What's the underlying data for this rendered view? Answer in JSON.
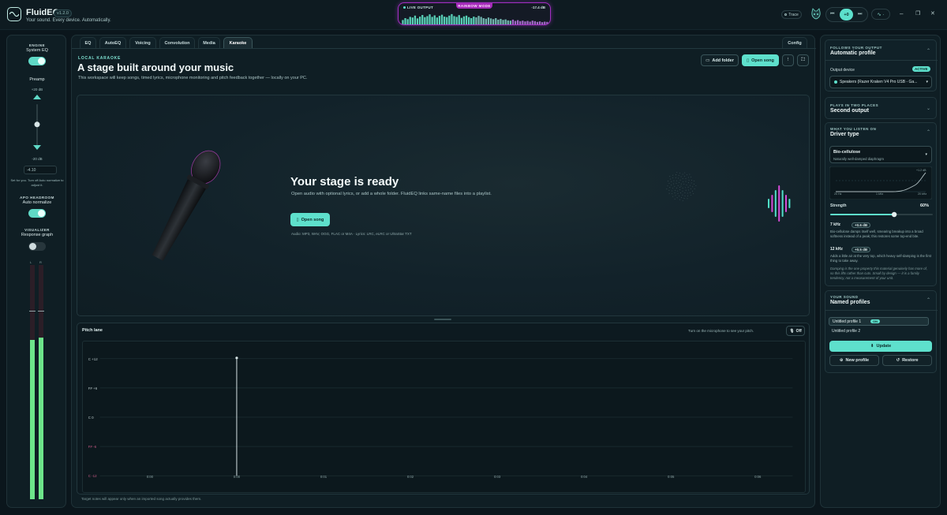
{
  "app": {
    "title": "FluidEQ",
    "version": "v1.2.0",
    "tagline": "Your sound. Every device. Automatically."
  },
  "live_output": {
    "label": "LIVE OUTPUT",
    "mode": "RAINBOW MODE",
    "db": "-17.4 dB",
    "levels": [
      0.35,
      0.5,
      0.42,
      0.6,
      0.55,
      0.7,
      0.48,
      0.62,
      0.75,
      0.58,
      0.66,
      0.8,
      0.6,
      0.72,
      0.55,
      0.68,
      0.77,
      0.62,
      0.58,
      0.7,
      0.82,
      0.66,
      0.6,
      0.74,
      0.52,
      0.64,
      0.7,
      0.58,
      0.5,
      0.62,
      0.56,
      0.68,
      0.6,
      0.5,
      0.45,
      0.55,
      0.48,
      0.42,
      0.5,
      0.38,
      0.44,
      0.36,
      0.4,
      0.32,
      0.3,
      0.38,
      0.28,
      0.34,
      0.26,
      0.3,
      0.24,
      0.28,
      0.22,
      0.3,
      0.26,
      0.2,
      0.24,
      0.18,
      0.22,
      0.2
    ]
  },
  "topbar": {
    "trace_label": "Trace",
    "play_label": "+0",
    "prev_icon": "skip-back-icon",
    "next_icon": "skip-forward-icon",
    "wave_label": "∿ ·",
    "minimize_glyph": "–",
    "restore_glyph": "❐",
    "close_glyph": "✕"
  },
  "left": {
    "engine_caption": "ENGINE",
    "engine_label": "System EQ",
    "engine_on": true,
    "preamp_label": "Preamp",
    "preamp_max": "+20 dB",
    "preamp_min": "-20 dB",
    "preamp_value": "-4.10",
    "preamp_level": 0.4,
    "preamp_hint": "Set for you. Turn off Auto normalize to adjust it.",
    "apo_caption": "APO HEADROOM",
    "apo_label": "Auto normalize",
    "apo_on": true,
    "vis_caption": "VISUALIZER",
    "vis_label": "Response graph",
    "vis_on": false,
    "meter_left_label": "L",
    "meter_right_label": "R",
    "meter_left_level": 0.68,
    "meter_right_level": 0.69
  },
  "tabs": [
    {
      "label": "EQ",
      "active": false
    },
    {
      "label": "AutoEQ",
      "active": false
    },
    {
      "label": "Voicing",
      "active": false
    },
    {
      "label": "Convolution",
      "active": false
    },
    {
      "label": "Media",
      "active": false
    },
    {
      "label": "Karaoke",
      "active": true
    },
    {
      "label": "Config",
      "active": false
    }
  ],
  "karaoke": {
    "caption": "LOCAL KARAOKE",
    "title": "A stage built around your music",
    "description": "This workspace will keep songs, timed lyrics, microphone monitoring and pitch feedback together — locally on your PC.",
    "add_folder": "Add folder",
    "open_song": "Open song",
    "stage_title": "Your stage is ready",
    "stage_desc": "Open audio with optional lyrics, or add a whole folder. FluidEQ links same-name files into a playlist.",
    "stage_open": "Open song",
    "formats": "Audio: MP3, WAV, OGG, FLAC or M4A · Lyrics: LRC, eLRC or UltraStar TXT"
  },
  "pitch": {
    "title": "Pitch lane",
    "hint": "Turn on the microphone to see your pitch.",
    "off_label": "Off",
    "y_labels": [
      "C +12",
      "F# +6",
      "C 0",
      "F# -6",
      "C -12"
    ],
    "x_labels": [
      "0:00",
      "0:00",
      "0:01",
      "0:02",
      "0:03",
      "0:04",
      "0:05",
      "0:06"
    ],
    "footer": "Target notes will appear only when an imported song actually provides them."
  },
  "right": {
    "output_caption": "FOLLOWS YOUR OUTPUT",
    "output_title": "Automatic profile",
    "output_device_label": "Output device",
    "active_badge": "ACTIVE",
    "device": "Speakers (Razer Kraken V4 Pro USB - Ga...",
    "second_caption": "PLAYS IN TWO PLACES",
    "second_title": "Second output",
    "driver_caption": "WHAT YOU LISTEN ON",
    "driver_title": "Driver type",
    "driver_name": "Bio-cellulose",
    "driver_sub": "Naturally well-damped diaphragm",
    "graph_max": "+1.2 dB",
    "graph_x": [
      "20 Hz",
      "1 kHz",
      "20 kHz"
    ],
    "strength_label": "Strength",
    "strength_value": "60%",
    "strength_level": 0.6,
    "f1": "7 kHz",
    "f1_badge": "+0.6 dB",
    "f1_desc": "Bio-cellulose damps itself well, smearing breakup into a broad softness instead of a peak; this restores some top-end bite.",
    "f2": "12 kHz",
    "f2_badge": "+0.5 dB",
    "f2_desc": "Adds a little air at the very top, which heavy self-damping is the first thing to take away.",
    "damping_note": "Damping is the one property this material genuinely has more of, so this lifts rather than cuts. Small by design — it is a family tendency, not a measurement of your unit.",
    "profiles_caption": "YOUR SOUND",
    "profiles_title": "Named profiles",
    "profiles": [
      {
        "name": "Untitled profile 1",
        "on": true
      },
      {
        "name": "Untitled profile 2",
        "on": false
      }
    ],
    "on_badge": "ON",
    "update_label": "Update",
    "new_label": "New profile",
    "restore_label": "Restore"
  }
}
